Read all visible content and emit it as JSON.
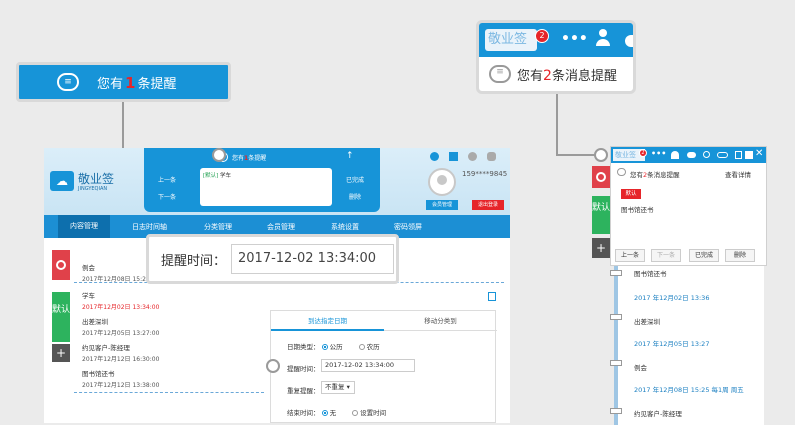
{
  "callout_reminder": {
    "prefix": "您有",
    "count": "1",
    "suffix": "条提醒"
  },
  "callout_msg": {
    "logo": "敬业签",
    "badge": "2",
    "prefix": "您有",
    "count": "2",
    "suffix": "条消息提醒"
  },
  "app": {
    "brand": "敬业签",
    "brand_sub": "JINGYEQIAN",
    "phone": "159****9845",
    "member_btn": "会员管理",
    "logout_btn": "退出登录",
    "popup": {
      "prefix": "您有",
      "count": "1",
      "suffix": "条提醒",
      "prev": "上一条",
      "next": "下一条",
      "done": "已完成",
      "delete": "删除",
      "tag": "[默认]",
      "content": "学车"
    },
    "nav": [
      "内容管理",
      "日志时间轴",
      "分类管理",
      "会员管理",
      "系统设置",
      "密码领屏"
    ],
    "side": {
      "default": "默认",
      "plus": "+"
    },
    "notes": [
      {
        "title": "例会",
        "date": "2017年12月08日 15:25:08"
      },
      {
        "title": "学车",
        "date": "2017年12月02日 13:34:00"
      },
      {
        "title": "出差深圳",
        "date": "2017年12月05日 13:27:00"
      },
      {
        "title": "约见客户-陈经理",
        "date": "2017年12月12日 16:30:00"
      },
      {
        "title": "图书馆还书",
        "date": "2017年12月12日 13:38:00"
      }
    ],
    "form": {
      "tab_reminder": "到达指定日期",
      "tab_move": "移动分类到",
      "date_type_label": "日期类型：",
      "solar": "公历",
      "lunar": "农历",
      "remind_time_label": "提醒时间：",
      "remind_time_value": "2017-12-02 13:34:00",
      "repeat_label": "重复提醒：",
      "repeat_value": "不重复",
      "end_time_label": "结束时间：",
      "end_none": "无",
      "end_set": "设置时间"
    }
  },
  "time_callout": {
    "label": "提醒时间：",
    "value": "2017-12-02 13:34:00"
  },
  "right_panel": {
    "logo": "敬业签",
    "badge": "2",
    "prefix": "您有",
    "count": "2",
    "suffix": "条消息提醒",
    "detail": "查看详情",
    "tag": "默认",
    "content": "图书馆还书",
    "prev": "上一条",
    "next": "下一条",
    "done": "已完成",
    "delete": "删除",
    "side_default": "默认",
    "side_plus": "+",
    "list": [
      {
        "title": "图书馆还书",
        "date": ""
      },
      {
        "title": "",
        "date": "2017 年12月02日 13:36"
      },
      {
        "title": "出差深圳",
        "date": ""
      },
      {
        "title": "",
        "date": "2017 年12月05日 13:27"
      },
      {
        "title": "例会",
        "date": ""
      },
      {
        "title": "",
        "date": "2017 年12月08日 15:25 每1周 周五"
      },
      {
        "title": "约见客户-陈经理",
        "date": ""
      }
    ]
  }
}
